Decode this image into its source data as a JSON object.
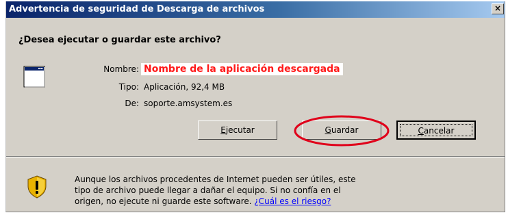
{
  "window": {
    "title": "Advertencia de seguridad de Descarga de archivos",
    "close_label": "×"
  },
  "question": "¿Desea ejecutar o guardar este archivo?",
  "file": {
    "name_label": "Nombre:",
    "name_value": "Nombre de la aplicación descargada",
    "type_label": "Tipo:",
    "type_value": "Aplicación, 92,4 MB",
    "from_label": "De:",
    "from_value": "soporte.amsystem.es"
  },
  "buttons": {
    "run_first": "E",
    "run_rest": "jecutar",
    "save_first": "G",
    "save_rest": "uardar",
    "cancel_first": "C",
    "cancel_rest": "ancelar"
  },
  "warning": {
    "line1": "Aunque los archivos procedentes de Internet pueden ser útiles, este",
    "line2": "tipo de archivo puede llegar a dañar el equipo. Si no confía en el",
    "line3_text": "origen, no ejecute ni guarde este software. ",
    "risk_link": "¿Cuál es el riesgo?"
  },
  "colors": {
    "title_bar_start": "#0a246a",
    "title_bar_end": "#a6caf0",
    "dialog_bg": "#d4d0c8",
    "app_name_text": "#ff1a1a",
    "highlight_circle": "#e0001a",
    "link": "#0000ff"
  },
  "icons": {
    "file": "application-window-icon",
    "warning": "security-shield-warning-icon",
    "close": "close-icon"
  }
}
